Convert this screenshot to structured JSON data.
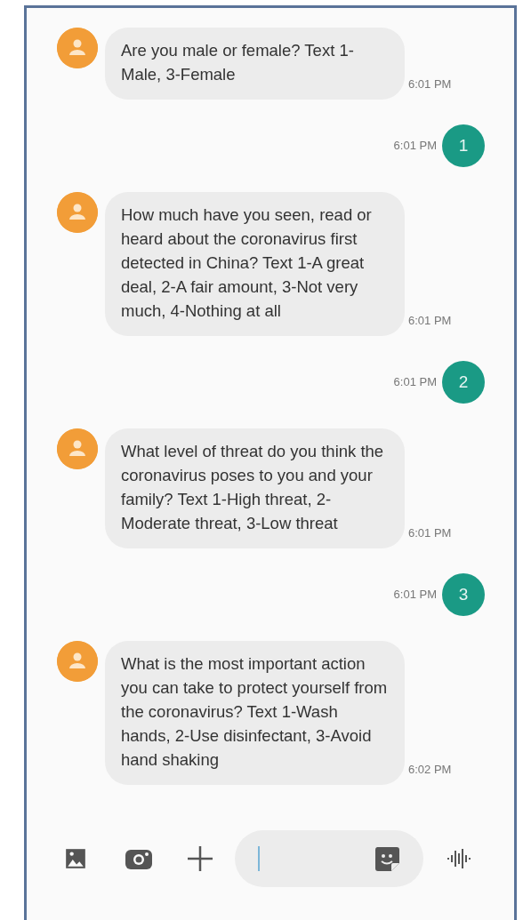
{
  "messages": [
    {
      "kind": "incoming",
      "text": "Are you male or female? Text 1-Male, 3-Female",
      "time": "6:01 PM"
    },
    {
      "kind": "outgoing",
      "text": "1",
      "time": "6:01 PM"
    },
    {
      "kind": "incoming",
      "text": "How much have you seen, read or heard about the coronavirus first detected in China? Text 1-A great deal, 2-A fair amount, 3-Not very much, 4-Nothing at all",
      "time": "6:01 PM"
    },
    {
      "kind": "outgoing",
      "text": "2",
      "time": "6:01 PM"
    },
    {
      "kind": "incoming",
      "text": "What level of threat do you think the coronavirus poses to you and your family? Text 1-High threat, 2-Moderate threat, 3-Low threat",
      "time": "6:01 PM"
    },
    {
      "kind": "outgoing",
      "text": "3",
      "time": "6:01 PM"
    },
    {
      "kind": "incoming",
      "text": "What is the most important action you can take to protect yourself from the coronavirus? Text 1-Wash hands, 2-Use disinfectant, 3-Avoid hand shaking",
      "time": "6:02 PM"
    }
  ]
}
